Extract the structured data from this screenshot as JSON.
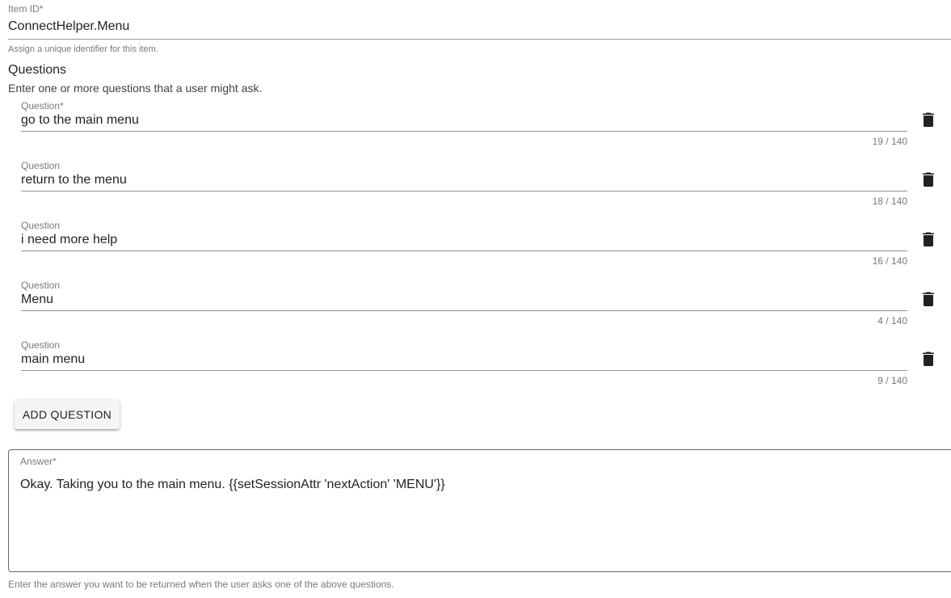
{
  "item_id": {
    "label": "Item ID*",
    "value": "ConnectHelper.Menu",
    "helper": "Assign a unique identifier for this item."
  },
  "questions": {
    "title": "Questions",
    "description": "Enter one or more questions that a user might ask.",
    "items": [
      {
        "label": "Question*",
        "value": "go to the main menu",
        "counter": "19 / 140",
        "delete_icon": "trash-icon"
      },
      {
        "label": "Question",
        "value": "return to the menu",
        "counter": "18 / 140",
        "delete_icon": "trash-icon"
      },
      {
        "label": "Question",
        "value": "i need more help",
        "counter": "16 / 140",
        "delete_icon": "trash-icon"
      },
      {
        "label": "Question",
        "value": "Menu",
        "counter": "4 / 140",
        "delete_icon": "trash-icon"
      },
      {
        "label": "Question",
        "value": "main menu",
        "counter": "9 / 140",
        "delete_icon": "trash-icon"
      }
    ],
    "add_button_label": "ADD QUESTION"
  },
  "answer": {
    "label": "Answer*",
    "value": "Okay. Taking you to the main menu. {{setSessionAttr 'nextAction' 'MENU'}}",
    "helper": "Enter the answer you want to be returned when the user asks one of the above questions."
  },
  "colors": {
    "text_primary": "#212121",
    "text_secondary": "#757575",
    "button_bg": "#f5f5f5"
  }
}
